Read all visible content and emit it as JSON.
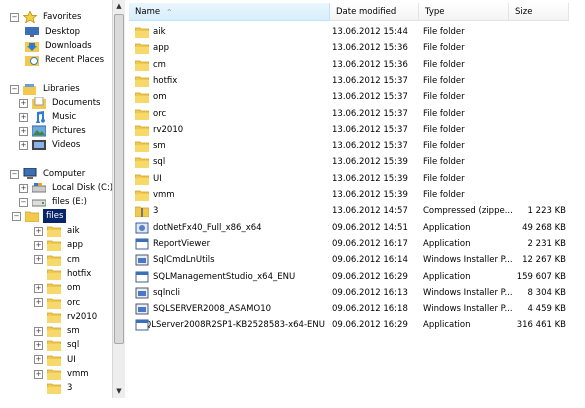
{
  "nav": {
    "favorites": {
      "label": "Favorites",
      "items": [
        "Desktop",
        "Downloads",
        "Recent Places"
      ]
    },
    "libraries": {
      "label": "Libraries",
      "items": [
        "Documents",
        "Music",
        "Pictures",
        "Videos"
      ]
    },
    "computer": {
      "label": "Computer",
      "items": [
        "Local Disk (C:)",
        "files (E:)"
      ]
    },
    "files_folder": "files",
    "subfolders": [
      "aik",
      "app",
      "cm",
      "hotfix",
      "om",
      "orc",
      "rv2010",
      "sm",
      "sql",
      "UI",
      "vmm",
      "3"
    ]
  },
  "columns": {
    "name": "Name",
    "date": "Date modified",
    "type": "Type",
    "size": "Size"
  },
  "files": [
    {
      "name": "aik",
      "date": "13.06.2012 15:44",
      "type": "File folder",
      "size": "",
      "icon": "folder"
    },
    {
      "name": "app",
      "date": "13.06.2012 15:36",
      "type": "File folder",
      "size": "",
      "icon": "folder"
    },
    {
      "name": "cm",
      "date": "13.06.2012 15:36",
      "type": "File folder",
      "size": "",
      "icon": "folder"
    },
    {
      "name": "hotfix",
      "date": "13.06.2012 15:37",
      "type": "File folder",
      "size": "",
      "icon": "folder"
    },
    {
      "name": "om",
      "date": "13.06.2012 15:37",
      "type": "File folder",
      "size": "",
      "icon": "folder"
    },
    {
      "name": "orc",
      "date": "13.06.2012 15:37",
      "type": "File folder",
      "size": "",
      "icon": "folder"
    },
    {
      "name": "rv2010",
      "date": "13.06.2012 15:37",
      "type": "File folder",
      "size": "",
      "icon": "folder"
    },
    {
      "name": "sm",
      "date": "13.06.2012 15:37",
      "type": "File folder",
      "size": "",
      "icon": "folder"
    },
    {
      "name": "sql",
      "date": "13.06.2012 15:39",
      "type": "File folder",
      "size": "",
      "icon": "folder"
    },
    {
      "name": "UI",
      "date": "13.06.2012 15:39",
      "type": "File folder",
      "size": "",
      "icon": "folder"
    },
    {
      "name": "vmm",
      "date": "13.06.2012 15:39",
      "type": "File folder",
      "size": "",
      "icon": "folder"
    },
    {
      "name": "3",
      "date": "13.06.2012 14:57",
      "type": "Compressed (zippe...",
      "size": "1 223 KB",
      "icon": "zip"
    },
    {
      "name": "dotNetFx40_Full_x86_x64",
      "date": "09.06.2012 14:51",
      "type": "Application",
      "size": "49 268 KB",
      "icon": "setup"
    },
    {
      "name": "ReportViewer",
      "date": "09.06.2012 16:17",
      "type": "Application",
      "size": "2 231 KB",
      "icon": "app"
    },
    {
      "name": "SqlCmdLnUtils",
      "date": "09.06.2012 16:14",
      "type": "Windows Installer P...",
      "size": "12 267 KB",
      "icon": "msi"
    },
    {
      "name": "SQLManagementStudio_x64_ENU",
      "date": "09.06.2012 16:29",
      "type": "Application",
      "size": "159 607 KB",
      "icon": "app"
    },
    {
      "name": "sqlncli",
      "date": "09.06.2012 16:13",
      "type": "Windows Installer P...",
      "size": "8 304 KB",
      "icon": "msi"
    },
    {
      "name": "SQLSERVER2008_ASAMO10",
      "date": "09.06.2012 16:18",
      "type": "Windows Installer P...",
      "size": "4 459 KB",
      "icon": "msi"
    },
    {
      "name": "SQLServer2008R2SP1-KB2528583-x64-ENU",
      "date": "09.06.2012 16:29",
      "type": "Application",
      "size": "316 461 KB",
      "icon": "app"
    }
  ],
  "colors": {
    "folder": "#f2c94c",
    "selection": "#0a246a",
    "header_hover": "#d7eefc"
  }
}
